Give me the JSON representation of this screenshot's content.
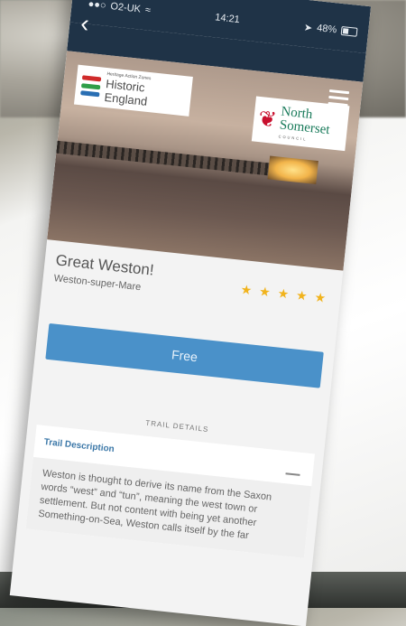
{
  "status_bar": {
    "carrier": "O2-UK",
    "time": "14:21",
    "battery": "48%"
  },
  "nav": {
    "back_icon": "chevron-left-icon",
    "menu_icon": "hamburger-menu-icon"
  },
  "logos": {
    "historic_england": {
      "tagline": "Heritage Action Zones",
      "name": "Historic England"
    },
    "north_somerset": {
      "line1": "North",
      "line2": "Somerset",
      "subline": "COUNCIL"
    }
  },
  "trail": {
    "title": "Great Weston!",
    "location": "Weston-super-Mare",
    "rating": 5
  },
  "actions": {
    "free_label": "Free"
  },
  "details": {
    "section_label": "TRAIL DETAILS",
    "card_title": "Trail Description",
    "collapse_symbol": "—",
    "description": "Weston is thought to derive its name from the Saxon words “west” and “tun”, meaning the west town or settlement. But not content with being yet another Something-on-Sea, Weston calls itself by the far"
  },
  "colors": {
    "header": "#1f3347",
    "accent_blue": "#4a91c9",
    "star": "#f1b31c",
    "title_link": "#3c78a8"
  }
}
